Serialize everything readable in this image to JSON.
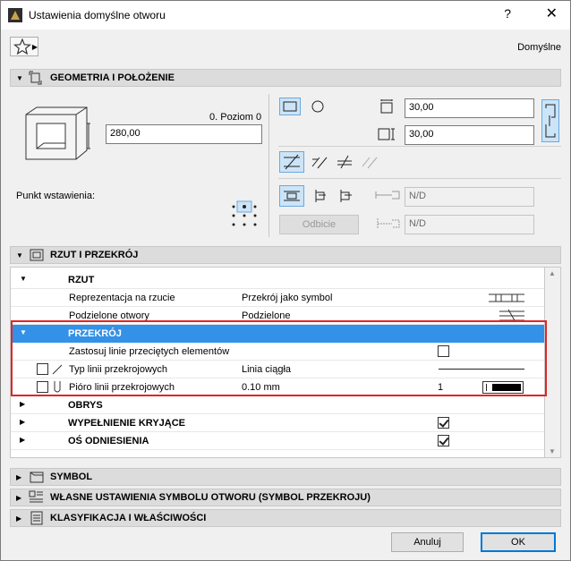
{
  "window": {
    "title": "Ustawienia domyślne otworu",
    "help": "?",
    "close": "✕"
  },
  "toolbar": {
    "favorites_icon": "star-icon",
    "defaults_label": "Domyślne"
  },
  "geometry": {
    "header": "GEOMETRIA I POŁOŻENIE",
    "level_label": "0. Poziom 0",
    "height_value": "280,00",
    "insertion_point_label": "Punkt wstawienia:",
    "width_value": "30,00",
    "depth_value": "30,00",
    "mirror_button": "Odbicie",
    "nd_1": "N/D",
    "nd_2": "N/D"
  },
  "section": {
    "header": "RZUT I PRZEKRÓJ",
    "rzut": "RZUT",
    "rows": [
      {
        "label": "Reprezentacja na rzucie",
        "value": "Przekrój jako symbol"
      },
      {
        "label": "Podzielone otwory",
        "value": "Podzielone"
      }
    ],
    "przekroj": "PRZEKRÓJ",
    "przekroj_rows": [
      {
        "label": "Zastosuj linie przeciętych elementów"
      },
      {
        "label": "Typ linii przekrojowych",
        "value": "Linia ciągła"
      },
      {
        "label": "Pióro linii przekrojowych",
        "value": "0.10 mm",
        "pen": "1"
      }
    ],
    "obrys": "OBRYS",
    "wypelnienie": "WYPEŁNIENIE KRYJĄCE",
    "os": "OŚ ODNIESIENIA"
  },
  "panels": {
    "symbol": "SYMBOL",
    "custom": "WŁASNE USTAWIENIA SYMBOLU OTWORU (SYMBOL PRZEKROJU)",
    "classification": "KLASYFIKACJA I WŁAŚCIWOŚCI"
  },
  "footer": {
    "cancel": "Anuluj",
    "ok": "OK"
  },
  "colors": {
    "selection": "#3391e8",
    "highlight": "#e02626",
    "accent": "#0078d7"
  }
}
